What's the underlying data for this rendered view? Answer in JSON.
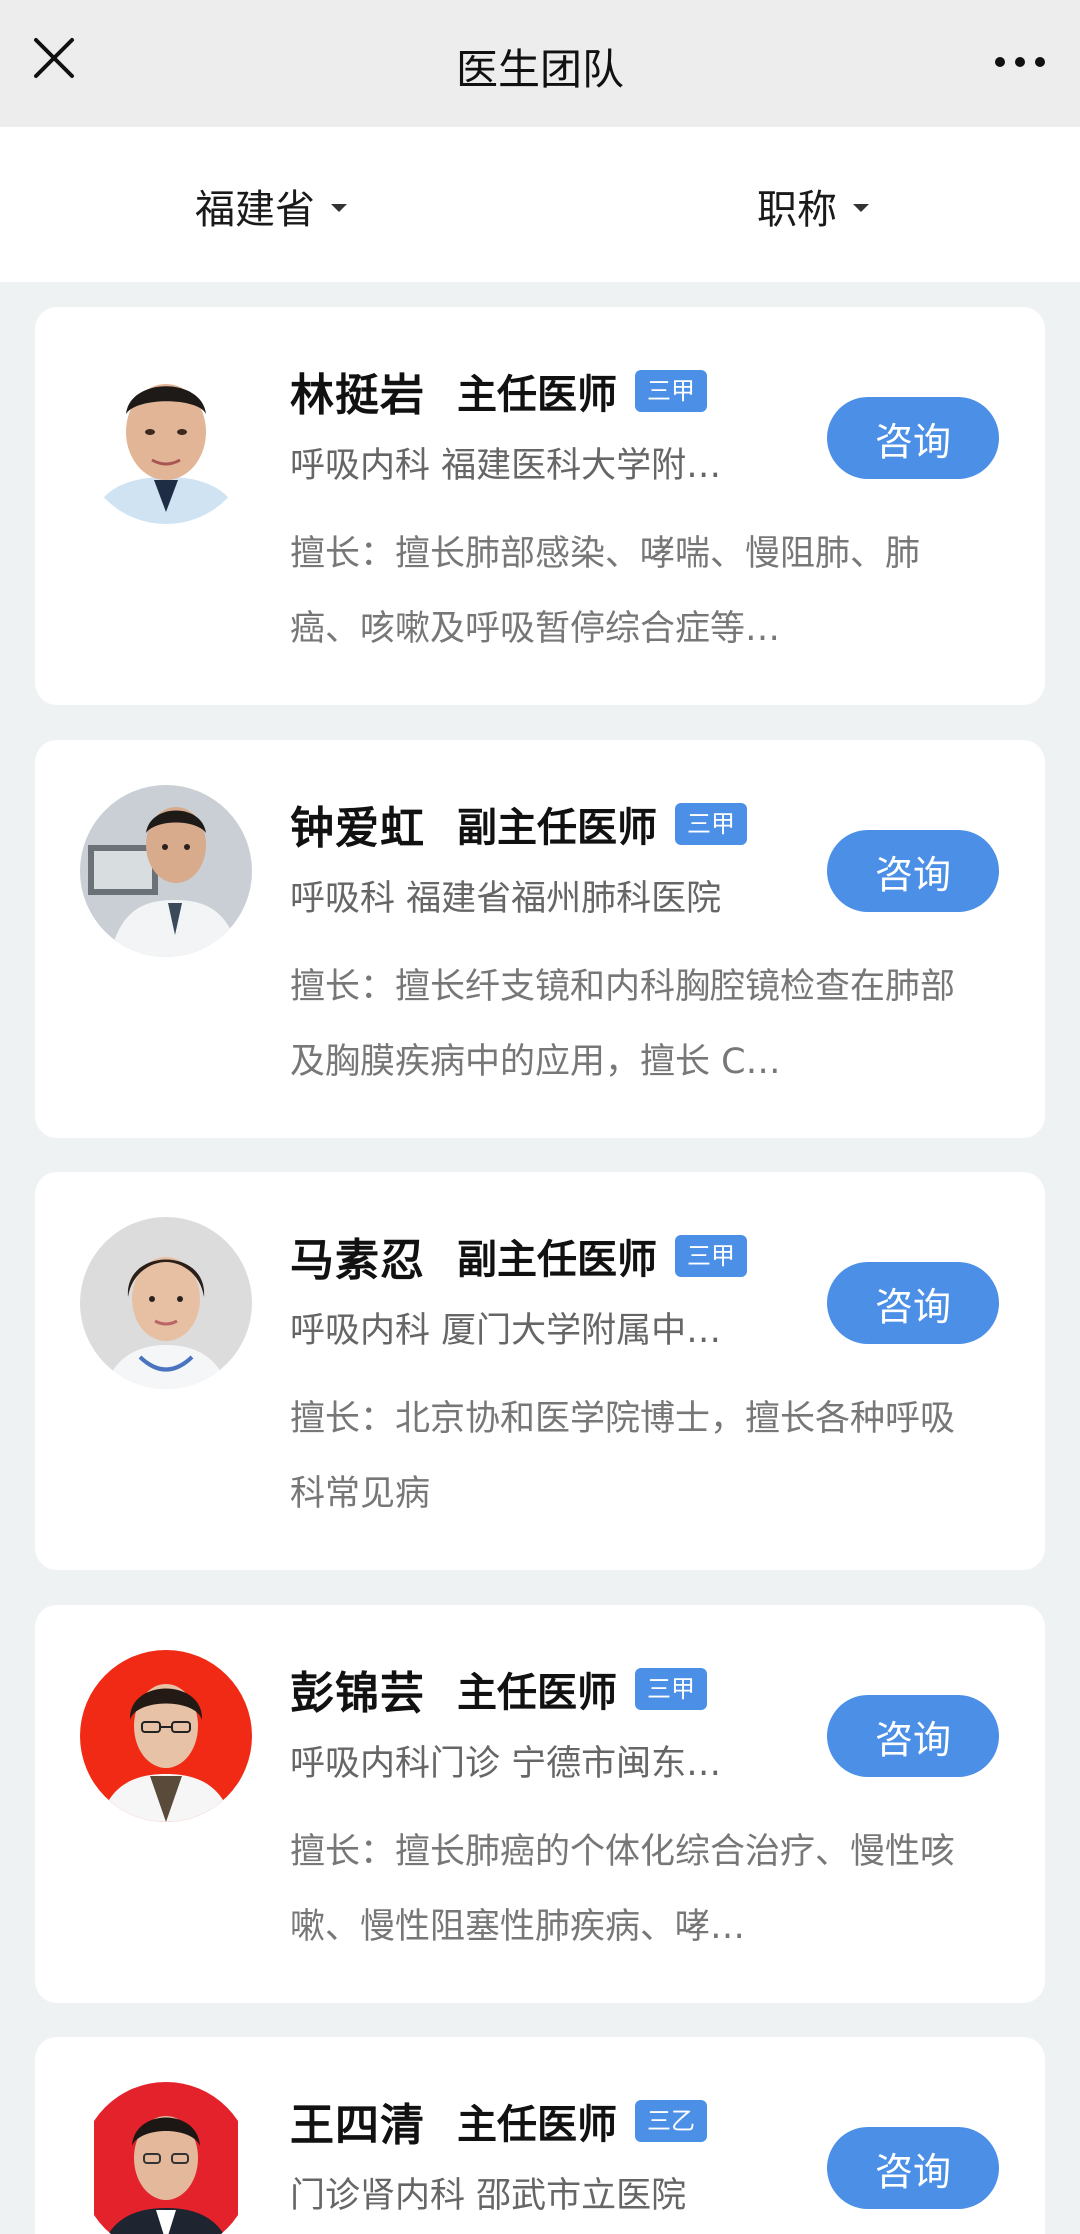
{
  "header": {
    "title": "医生团队",
    "close_icon": "close-icon",
    "more_icon": "more-icon"
  },
  "filters": {
    "province": "福建省",
    "title": "职称"
  },
  "doctors": [
    {
      "name": "林挺岩",
      "title": "主任医师",
      "grade": "三甲",
      "dept": "呼吸内科 福建医科大学附…",
      "expertise": "擅长：擅长肺部感染、哮喘、慢阻肺、肺癌、咳嗽及呼吸暂停综合症等…",
      "consult": "咨询"
    },
    {
      "name": "钟爱虹",
      "title": "副主任医师",
      "grade": "三甲",
      "dept": "呼吸科 福建省福州肺科医院",
      "expertise": "擅长：擅长纤支镜和内科胸腔镜检查在肺部及胸膜疾病中的应用，擅长 C…",
      "consult": "咨询"
    },
    {
      "name": "马素忍",
      "title": "副主任医师",
      "grade": "三甲",
      "dept": "呼吸内科 厦门大学附属中…",
      "expertise": "擅长：北京协和医学院博士，擅长各种呼吸科常见病",
      "consult": "咨询"
    },
    {
      "name": "彭锦芸",
      "title": "主任医师",
      "grade": "三甲",
      "dept": "呼吸内科门诊 宁德市闽东…",
      "expertise": "擅长：擅长肺癌的个体化综合治疗、慢性咳嗽、慢性阻塞性肺疾病、哮…",
      "consult": "咨询"
    },
    {
      "name": "王四清",
      "title": "主任医师",
      "grade": "三乙",
      "dept": "门诊肾内科 邵武市立医院",
      "expertise": "",
      "consult": "咨询"
    }
  ]
}
